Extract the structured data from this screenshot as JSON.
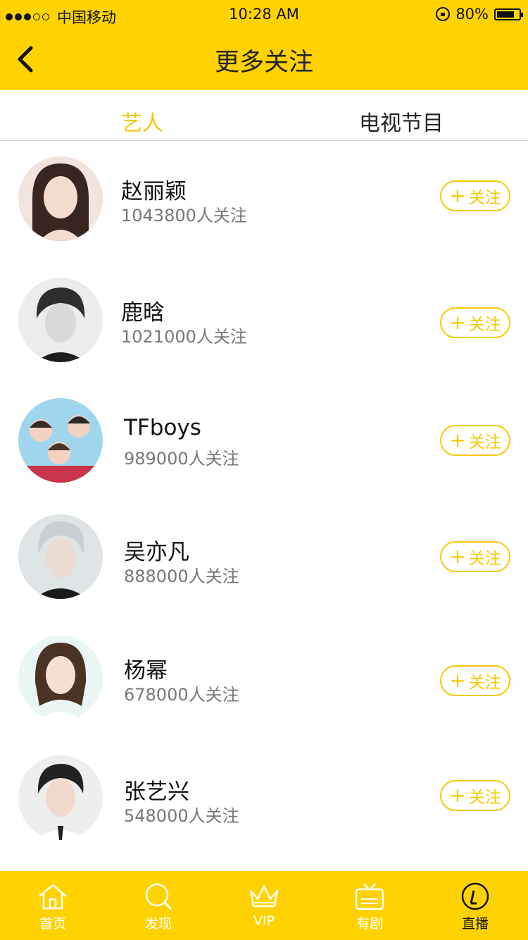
{
  "status_bar": {
    "carrier": "中国移动",
    "time": "10:28 AM",
    "battery": "80%",
    "battery_level": 0.8,
    "signal_bars": 3,
    "signal_total": 5
  },
  "nav": {
    "title": "更多关注"
  },
  "tabs": [
    {
      "label": "艺人",
      "active": true
    },
    {
      "label": "电视节目",
      "active": false
    }
  ],
  "follow_label": "关注",
  "artists": [
    {
      "name": "赵丽颖",
      "followers": "1043800人关注"
    },
    {
      "name": "鹿晗",
      "followers": "1021000人关注"
    },
    {
      "name": "TFboys",
      "followers": "989000人关注"
    },
    {
      "name": "吴亦凡",
      "followers": "888000人关注"
    },
    {
      "name": "杨幂",
      "followers": "678000人关注"
    },
    {
      "name": "张艺兴",
      "followers": "548000人关注"
    }
  ],
  "tabbar": [
    {
      "label": "首页",
      "icon": "home-icon",
      "active": false
    },
    {
      "label": "发现",
      "icon": "search-icon",
      "active": false
    },
    {
      "label": "VIP",
      "icon": "crown-icon",
      "active": false
    },
    {
      "label": "有剧",
      "icon": "tv-icon",
      "active": false
    },
    {
      "label": "直播",
      "icon": "live-icon",
      "active": true
    }
  ],
  "colors": {
    "accent": "#ffd200",
    "accent_text": "#f6c800"
  }
}
